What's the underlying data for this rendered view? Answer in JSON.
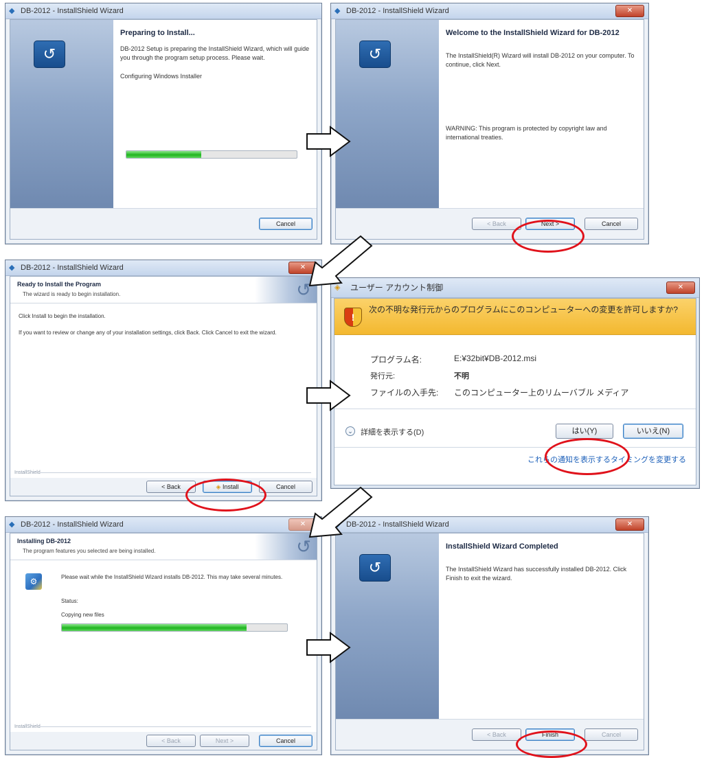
{
  "windows": {
    "w1": {
      "title": "DB-2012 - InstallShield Wizard",
      "heading": "Preparing to Install...",
      "body": "DB-2012 Setup is preparing the InstallShield Wizard, which will guide you through the program setup process.  Please wait.",
      "status": "Configuring Windows Installer",
      "progress": 0.44,
      "cancel": "Cancel"
    },
    "w2": {
      "title": "DB-2012 - InstallShield Wizard",
      "heading": "Welcome to the InstallShield Wizard for DB-2012",
      "body": "The InstallShield(R) Wizard will install DB-2012 on your computer. To continue, click Next.",
      "warning": "WARNING: This program is protected by copyright law and international treaties.",
      "back": "< Back",
      "next": "Next >",
      "cancel": "Cancel"
    },
    "w3": {
      "title": "DB-2012 - InstallShield Wizard",
      "banner_title": "Ready to Install the Program",
      "banner_sub": "The wizard is ready to begin installation.",
      "line1": "Click Install to begin the installation.",
      "line2": "If you want to review or change any of your installation settings, click Back. Click Cancel to exit the wizard.",
      "brand": "InstallShield",
      "back": "< Back",
      "install": "Install",
      "cancel": "Cancel"
    },
    "w4": {
      "title": "ユーザー アカウント制御",
      "question": "次の不明な発行元からのプログラムにこのコンピューターへの変更を許可しますか?",
      "program_label": "プログラム名:",
      "program_value": "E:¥32bit¥DB-2012.msi",
      "publisher_label": "発行元:",
      "publisher_value": "不明",
      "source_label": "ファイルの入手先:",
      "source_value": "このコンピューター上のリムーバブル メディア",
      "details": "詳細を表示する(D)",
      "yes": "はい(Y)",
      "no": "いいえ(N)",
      "link": "これらの通知を表示するタイミングを変更する"
    },
    "w5": {
      "title": "DB-2012 - InstallShield Wizard",
      "banner_title": "Installing DB-2012",
      "banner_sub": "The program features you selected are being installed.",
      "body": "Please wait while the InstallShield Wizard installs DB-2012. This may take several minutes.",
      "status_label": "Status:",
      "status": "Copying new files",
      "progress": 0.82,
      "brand": "InstallShield",
      "back": "< Back",
      "next": "Next >",
      "cancel": "Cancel"
    },
    "w6": {
      "title": "DB-2012 - InstallShield Wizard",
      "heading": "InstallShield Wizard Completed",
      "body": "The InstallShield Wizard has successfully installed DB-2012. Click Finish to exit the wizard.",
      "back": "< Back",
      "finish": "Finish",
      "cancel": "Cancel"
    }
  },
  "colors": {
    "highlight_ring": "#e0121b",
    "progress_fill": "#1fb41f",
    "uac_bar": "#f3b82f"
  }
}
